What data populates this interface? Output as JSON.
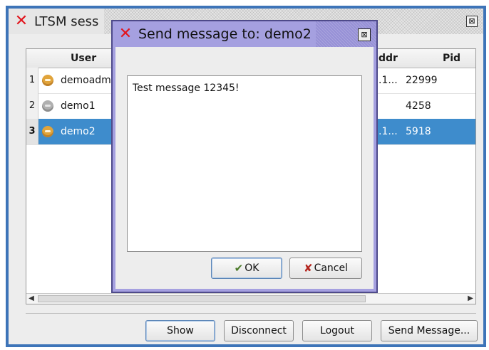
{
  "main_window": {
    "title": "LTSM sess",
    "close_glyph": "⊠"
  },
  "table": {
    "columns": [
      "User",
      "ddr",
      "Pid"
    ],
    "rows": [
      {
        "num": "1",
        "user": "demoadm",
        "addr": ".1...",
        "pid": "22999",
        "icon": "monkey-face-icon",
        "icon_color": "#e1a43b",
        "selected": false
      },
      {
        "num": "2",
        "user": "demo1",
        "addr": "",
        "pid": "4258",
        "icon": "monkey-face-icon",
        "icon_color": "#b0b0b0",
        "selected": false
      },
      {
        "num": "3",
        "user": "demo2",
        "addr": ".1...",
        "pid": "5918",
        "icon": "monkey-face-icon",
        "icon_color": "#e1a43b",
        "selected": true
      }
    ]
  },
  "buttons": {
    "show": "Show",
    "disconnect": "Disconnect",
    "logout": "Logout",
    "send_message": "Send Message..."
  },
  "dialog": {
    "title": "Send message to: demo2",
    "message": "Test message 12345!",
    "ok": "OK",
    "cancel": "Cancel"
  },
  "colors": {
    "selection": "#3e8ccc",
    "dialog_frame": "#a5a0e0",
    "main_frame": "#3d74b8",
    "app_icon": "#e2151d"
  }
}
